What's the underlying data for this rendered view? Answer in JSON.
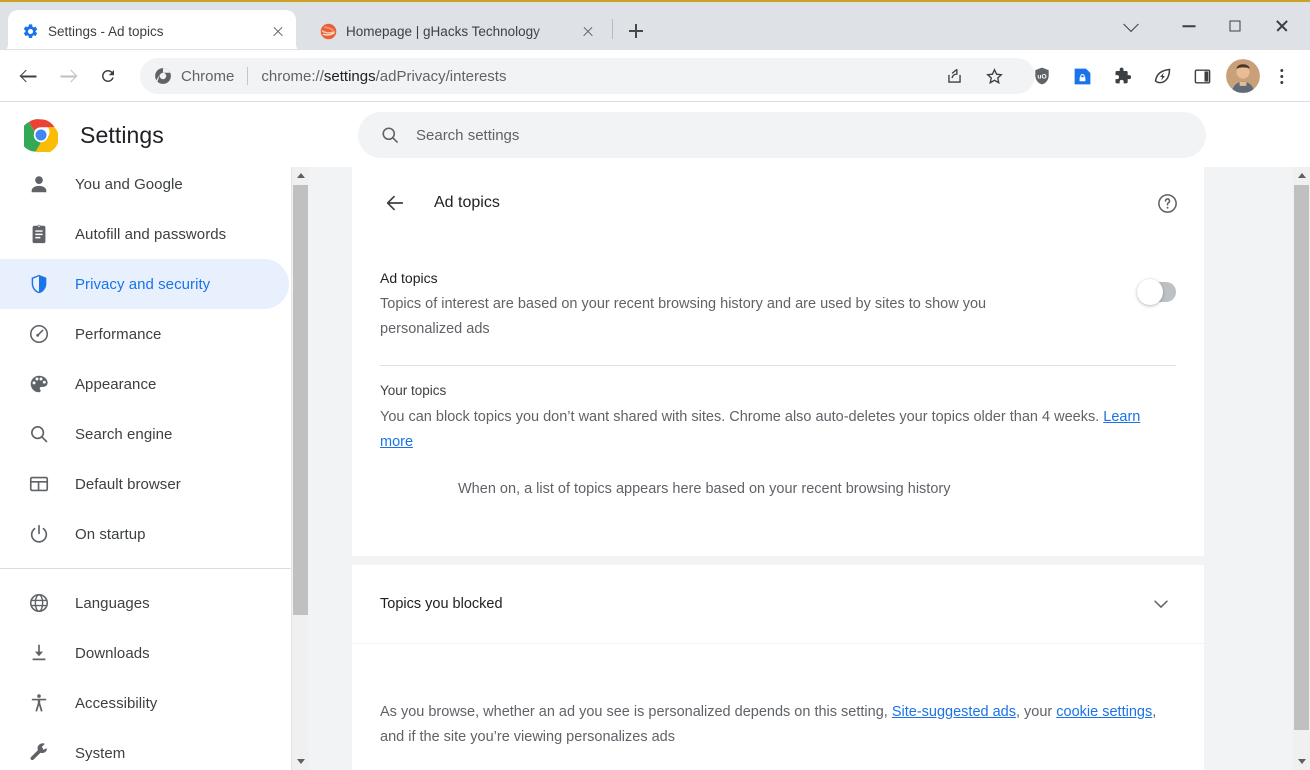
{
  "window": {
    "controls": [
      {
        "name": "tab-search",
        "icon": "chevron-down-icon",
        "label": "Search tabs"
      },
      {
        "name": "minimize",
        "icon": "minimize-icon",
        "label": "Minimize"
      },
      {
        "name": "maximize",
        "icon": "maximize-icon",
        "label": "Maximize"
      },
      {
        "name": "close",
        "icon": "close-icon",
        "label": "Close"
      }
    ]
  },
  "tabs": [
    {
      "title": "Settings - Ad topics",
      "favicon": "settings-gear-icon",
      "active": true
    },
    {
      "title": "Homepage | gHacks Technology",
      "favicon": "ghacks-favicon",
      "active": false
    }
  ],
  "new_tab_label": "New Tab",
  "toolbar": {
    "back_label": "Back",
    "forward_label": "Forward",
    "reload_label": "Reload",
    "omnibox": {
      "chip_label": "Chrome",
      "scheme": "chrome://",
      "url_bold": "settings",
      "url_rest": "/adPrivacy/interests",
      "full_url": "chrome://settings/adPrivacy/interests"
    },
    "actions": [
      {
        "name": "share-icon",
        "label": "Share this page"
      },
      {
        "name": "bookmark-star-icon",
        "label": "Bookmark this tab"
      },
      {
        "name": "ublock-shield-icon",
        "label": "uBlock Origin"
      },
      {
        "name": "lock-extension-icon",
        "label": "Extension"
      },
      {
        "name": "puzzle-piece-icon",
        "label": "Extensions"
      },
      {
        "name": "leaf-bolt-icon",
        "label": "Performance"
      },
      {
        "name": "side-panel-icon",
        "label": "Side panel"
      },
      {
        "name": "avatar",
        "label": "Profile"
      },
      {
        "name": "three-dot-menu-icon",
        "label": "Customize and control Google Chrome"
      }
    ]
  },
  "settings_header": {
    "logo": "chrome-logo-icon",
    "title": "Settings",
    "search_placeholder": "Search settings",
    "search_value": ""
  },
  "sidebar": {
    "items": [
      {
        "label": "You and Google",
        "icon": "person-icon",
        "selected": false
      },
      {
        "label": "Autofill and passwords",
        "icon": "clipboard-icon",
        "selected": false
      },
      {
        "label": "Privacy and security",
        "icon": "shield-icon",
        "selected": true
      },
      {
        "label": "Performance",
        "icon": "speedometer-icon",
        "selected": false
      },
      {
        "label": "Appearance",
        "icon": "palette-icon",
        "selected": false
      },
      {
        "label": "Search engine",
        "icon": "magnifier-icon",
        "selected": false
      },
      {
        "label": "Default browser",
        "icon": "browser-window-icon",
        "selected": false
      },
      {
        "label": "On startup",
        "icon": "power-icon",
        "selected": false
      }
    ],
    "items_group2": [
      {
        "label": "Languages",
        "icon": "globe-icon",
        "selected": false
      },
      {
        "label": "Downloads",
        "icon": "download-icon",
        "selected": false
      },
      {
        "label": "Accessibility",
        "icon": "accessibility-icon",
        "selected": false
      },
      {
        "label": "System",
        "icon": "wrench-icon",
        "selected": false
      }
    ]
  },
  "main": {
    "back_label": "Back",
    "page_title": "Ad topics",
    "help_label": "Help",
    "ad_topics": {
      "title": "Ad topics",
      "description": "Topics of interest are based on your recent browsing history and are used by sites to show you personalized ads",
      "toggle_state": "off",
      "toggle_label": "Ad topics"
    },
    "your_topics": {
      "title": "Your topics",
      "description_before": "You can block topics you don’t want shared with sites. Chrome also auto-deletes your topics older than 4 weeks. ",
      "learn_more": "Learn more",
      "empty_message": "When on, a list of topics appears here based on your recent browsing history"
    },
    "blocked": {
      "label": "Topics you blocked",
      "chevron": "chevron-down-icon",
      "expanded": false
    },
    "footer": {
      "part1": "As you browse, whether an ad you see is personalized depends on this setting, ",
      "link1": "Site-suggested ads",
      "part2": ", your ",
      "link2": "cookie settings",
      "part3": ", and if the site you’re viewing personalizes ads"
    }
  },
  "colors": {
    "accent": "#1a73e8",
    "selected_bg": "#e8f0fe",
    "toolbar_bg": "#ffffff",
    "tabstrip_bg": "#dee1e6",
    "page_bg": "#f1f3f4",
    "text_primary": "#202124",
    "text_secondary": "#5f6368",
    "top_border": "#c9a227"
  }
}
